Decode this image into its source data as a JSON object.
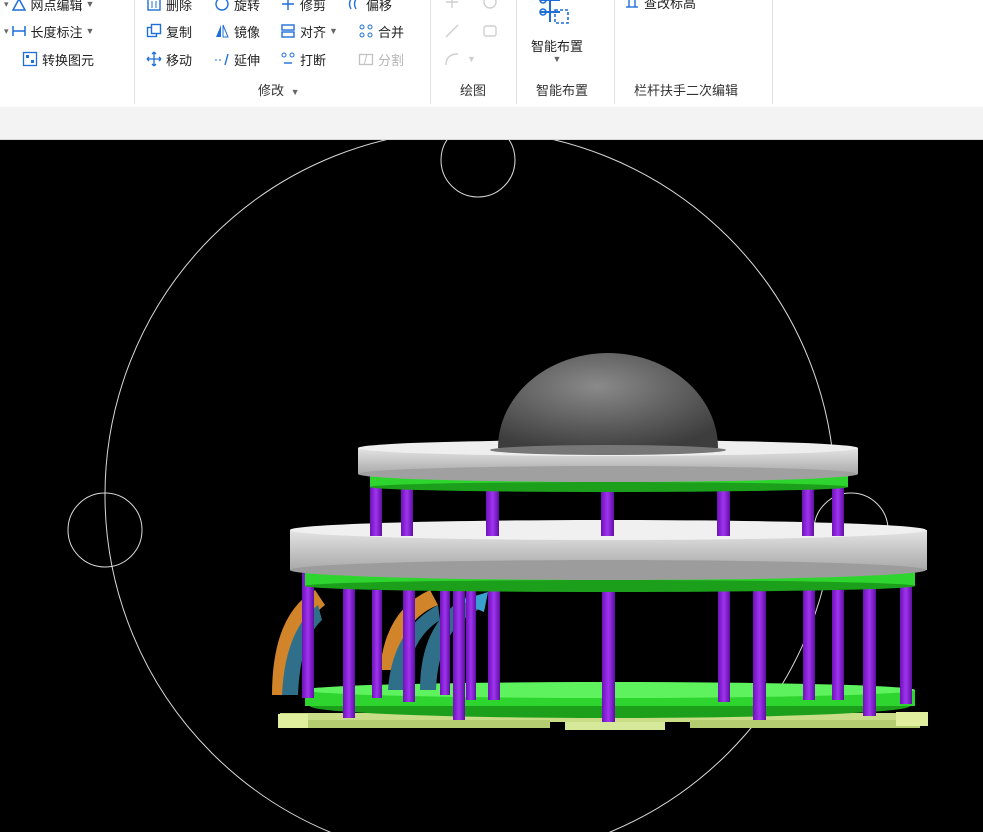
{
  "ribbon": {
    "col1": {
      "item_points": "网点编辑",
      "item_length": "长度标注",
      "item_convert": "转换图元"
    },
    "modify": {
      "delete": "删除",
      "rotate": "旋转",
      "trim": "修剪",
      "offset": "偏移",
      "copy": "复制",
      "mirror": "镜像",
      "align": "对齐",
      "merge": "合并",
      "move": "移动",
      "extend": "延伸",
      "break": "打断",
      "split": "分割",
      "group_label": "修改"
    },
    "draw": {
      "group_label": "绘图"
    },
    "smart": {
      "button_label": "智能布置",
      "group_label": "智能布置"
    },
    "railing": {
      "elevation_button": "查改标高",
      "group_label": "栏杆扶手二次编辑"
    }
  },
  "viewport": {
    "background": "#000000",
    "colors": {
      "slab": "#c9c9c9",
      "dome": "#5c5c5c",
      "column": "#8a1fd6",
      "beam": "#2fd52f",
      "footing": "#d6e89a",
      "stair": "#2f6f8a"
    }
  }
}
